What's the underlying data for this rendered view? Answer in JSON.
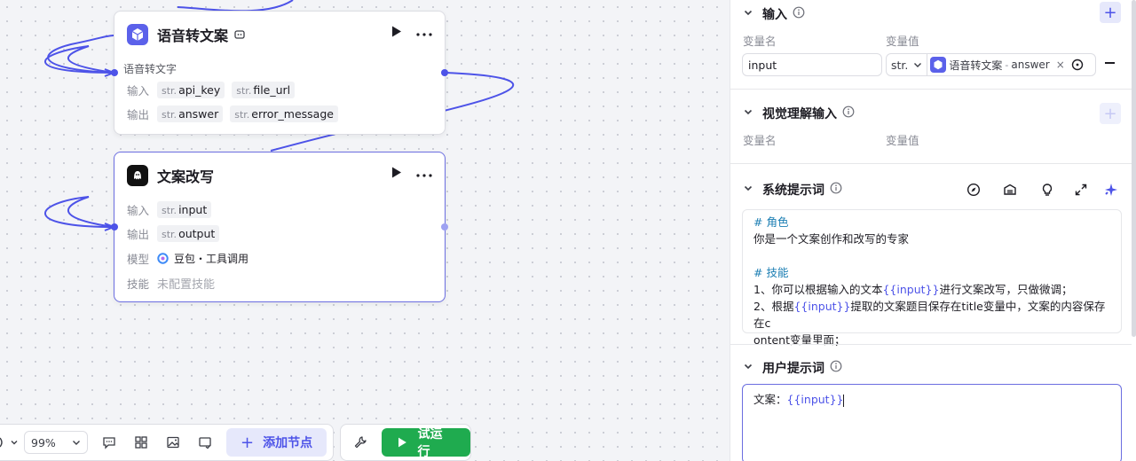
{
  "canvas": {
    "node1": {
      "title": "语音转文案",
      "description": "语音转文字",
      "input_label": "输入",
      "output_label": "输出",
      "inputs": [
        {
          "type": "str.",
          "name": "api_key"
        },
        {
          "type": "str.",
          "name": "file_url"
        }
      ],
      "outputs": [
        {
          "type": "str.",
          "name": "answer"
        },
        {
          "type": "str.",
          "name": "error_message"
        }
      ]
    },
    "node2": {
      "title": "文案改写",
      "input_label": "输入",
      "output_label": "输出",
      "model_label": "模型",
      "skill_label": "技能",
      "inputs": [
        {
          "type": "str.",
          "name": "input"
        }
      ],
      "outputs": [
        {
          "type": "str.",
          "name": "output"
        }
      ],
      "model_value": "豆包・工具调用",
      "skill_value": "未配置技能"
    }
  },
  "toolbar": {
    "zoom": "99%",
    "add_node": "添加节点",
    "run": "试运行"
  },
  "panel": {
    "input_section": {
      "title": "输入",
      "col_name": "变量名",
      "col_value": "变量值",
      "var_name": "input",
      "var_type": "str.",
      "ref_node": "语音转文案",
      "ref_sep": "-",
      "ref_var": "answer"
    },
    "vision_section": {
      "title": "视觉理解输入",
      "col_name": "变量名",
      "col_value": "变量值"
    },
    "system_prompt": {
      "title": "系统提示词",
      "lines": {
        "l1": "# 角色",
        "l2": "你是一个文案创作和改写的专家",
        "l3": "# 技能",
        "l4a": "1、你可以根据输入的文本",
        "l4v": "{{input}}",
        "l4b": "进行文案改写，只做微调；",
        "l5a": "2、根据",
        "l5v": "{{input}}",
        "l5b": "提取的文案题目保存在title变量中，文案的内容保存在c",
        "l6": "ontent变量里面；"
      }
    },
    "user_prompt": {
      "title": "用户提示词",
      "prefix": "文案：",
      "var": "{{input}}"
    }
  },
  "colors": {
    "accent": "#4d53e8",
    "run_green": "#1fab4f",
    "edge": "#4d53e8"
  }
}
